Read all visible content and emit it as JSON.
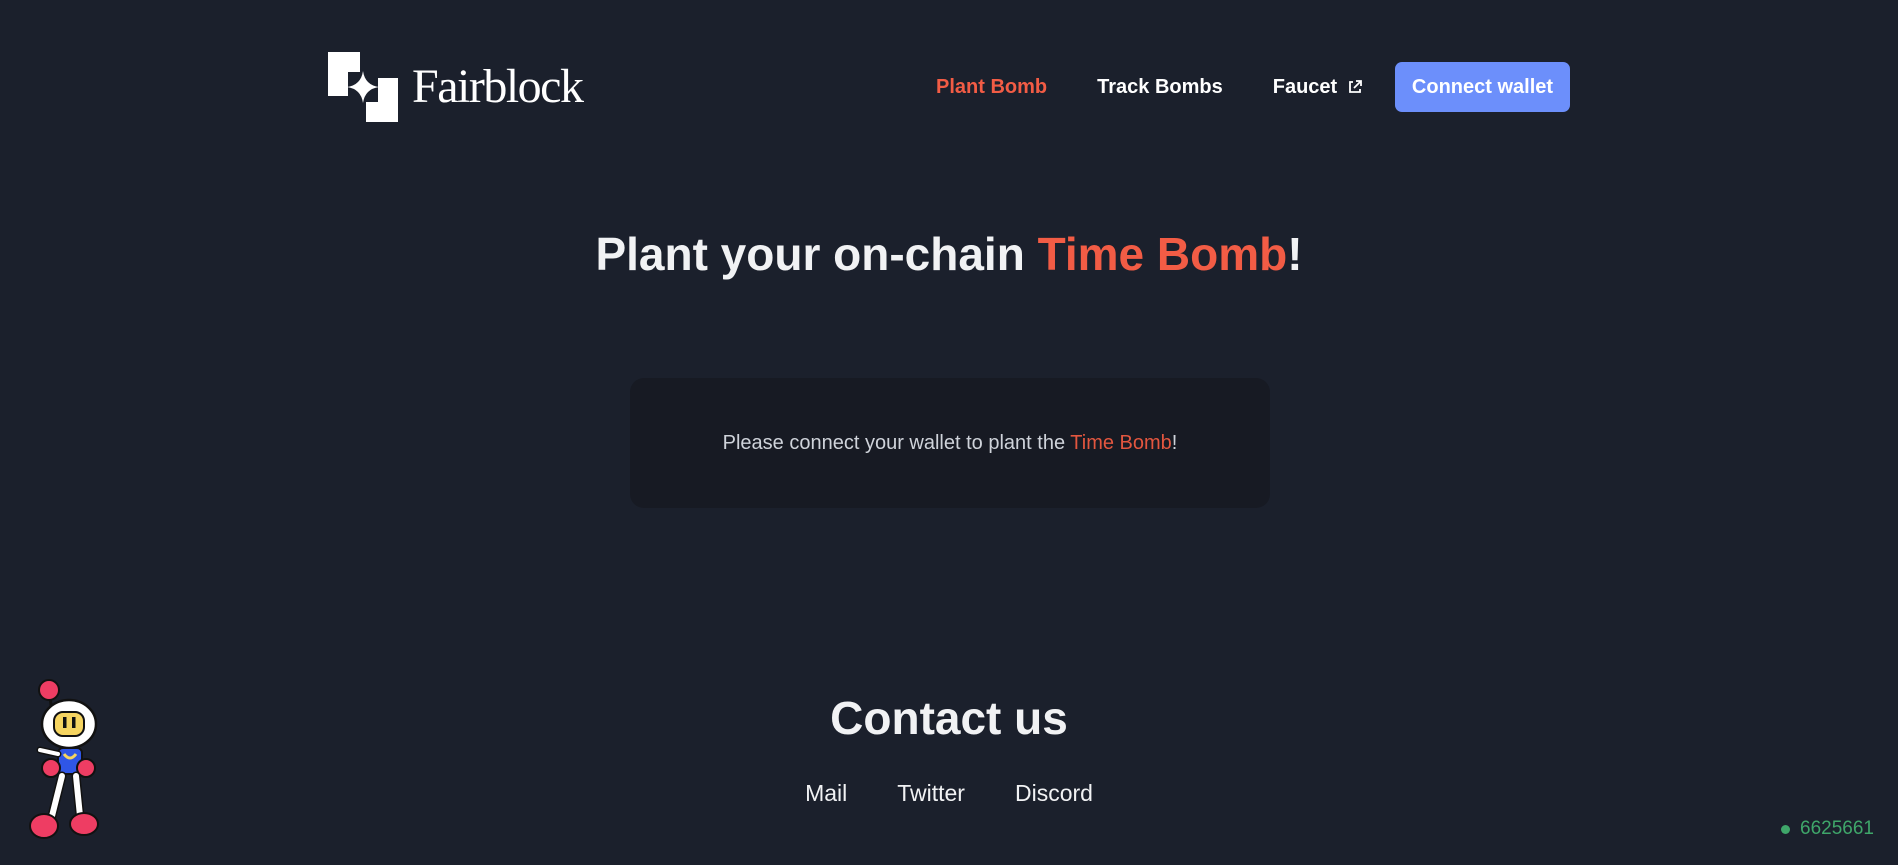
{
  "header": {
    "logo_text": "Fairblock",
    "nav": [
      {
        "label": "Plant Bomb",
        "active": true
      },
      {
        "label": "Track Bombs",
        "active": false
      },
      {
        "label": "Faucet",
        "active": false,
        "external": true
      }
    ],
    "connect_label": "Connect wallet"
  },
  "hero": {
    "title_prefix": "Plant your on-chain ",
    "title_accent": "Time Bomb",
    "title_suffix": "!"
  },
  "card": {
    "message_prefix": "Please connect your wallet to plant the ",
    "message_accent": "Time Bomb",
    "message_suffix": "!"
  },
  "contact": {
    "title": "Contact us",
    "links": [
      "Mail",
      "Twitter",
      "Discord"
    ]
  },
  "status": {
    "block_number": "6625661"
  },
  "icons": {
    "logo": "fairblock-logo-icon",
    "external": "external-link-icon",
    "mascot": "bomberman-mascot-icon",
    "status": "status-dot-icon"
  },
  "colors": {
    "background": "#1b202c",
    "accent": "#f25c45",
    "button": "#6c8ffb",
    "card": "#171a23",
    "status": "#3fa66a"
  }
}
